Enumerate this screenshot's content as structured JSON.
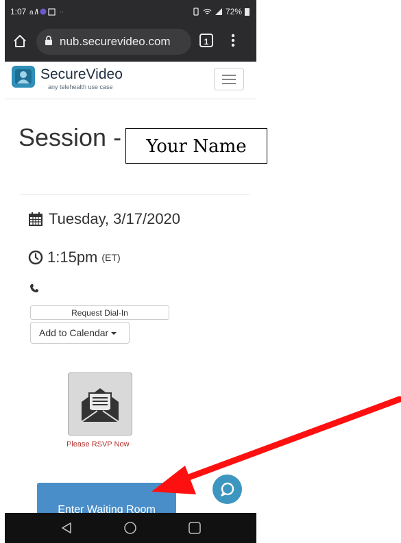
{
  "status_bar": {
    "time": "1:07",
    "battery": "72%"
  },
  "browser": {
    "url": "nub.securevideo.com",
    "tab_count": "1"
  },
  "site": {
    "brand": "SecureVideo",
    "tagline": "any telehealth use case"
  },
  "session": {
    "title_prefix": "Session -",
    "name_overlay": "Your Name",
    "date": "Tuesday, 3/17/2020",
    "time": "1:15pm",
    "timezone": "(ET)"
  },
  "actions": {
    "dial_in": "Request Dial-In",
    "calendar": "Add to Calendar",
    "rsvp": "Please RSVP Now",
    "enter": "Enter Waiting Room"
  },
  "colors": {
    "accent": "#4a8ec9",
    "rsvp_text": "#b0302a",
    "chat": "#3d96bf",
    "annotation_arrow": "#ff1010"
  }
}
